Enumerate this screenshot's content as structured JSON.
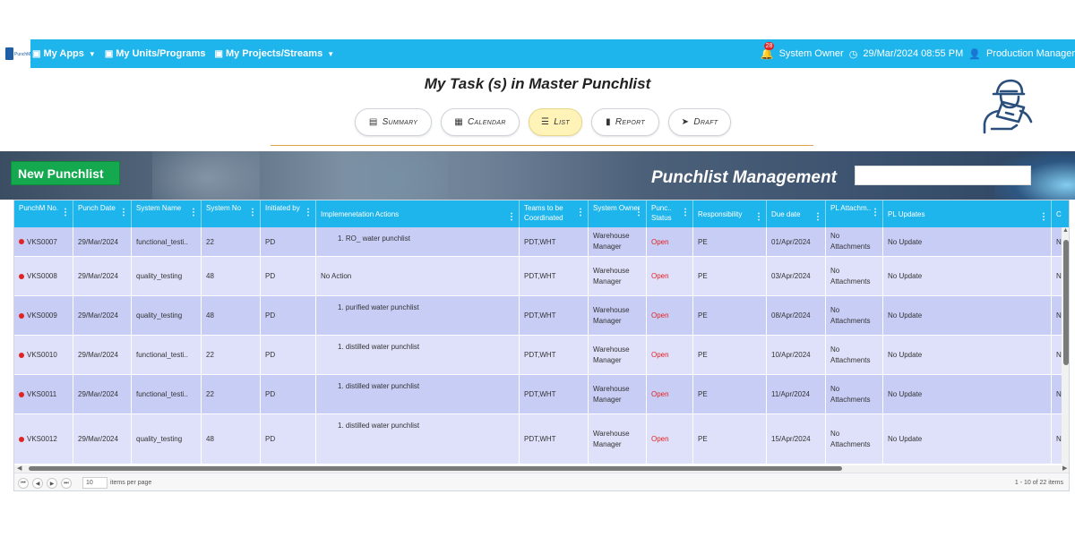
{
  "nav": {
    "items": [
      {
        "label": "My Apps",
        "icon": "briefcase-icon"
      },
      {
        "label": "My Units/Programs",
        "icon": "briefcase-icon"
      },
      {
        "label": "My Projects/Streams",
        "icon": "briefcase-icon"
      }
    ],
    "notification_count": "28",
    "role": "System Owner",
    "datetime": "29/Mar/2024 08:55 PM",
    "user": "Production Manager"
  },
  "page": {
    "title": "My Task (s) in Master Punchlist"
  },
  "tabs": [
    {
      "label": "Summary",
      "icon": "▤",
      "active": false
    },
    {
      "label": "Calendar",
      "icon": "▦",
      "active": false
    },
    {
      "label": "List",
      "icon": "☰",
      "active": true
    },
    {
      "label": "Report",
      "icon": "▮",
      "active": false
    },
    {
      "label": "Draft",
      "icon": "➤",
      "active": false
    }
  ],
  "banner": {
    "new_button": "New Punchlist",
    "title": "Punchlist Management",
    "search_value": ""
  },
  "grid": {
    "columns": [
      "PunchM No.",
      "Punch Date",
      "System Name",
      "System No",
      "Initiated by",
      "Implemenetation Actions",
      "Teams to be Coordinated",
      "System Owner",
      "Punc.. Status",
      "Responsibility",
      "Due date",
      "PL Attachm..",
      "PL Updates",
      "C"
    ],
    "rows": [
      {
        "no": "VKS0007",
        "date": "29/Mar/2024",
        "system": "functional_testi..",
        "sysno": "22",
        "init": "PD",
        "action": "1. RO_ water punchlist",
        "teams": "PDT,WHT",
        "owner": "Warehouse Manager",
        "status": "Open",
        "resp": "PE",
        "due": "01/Apr/2024",
        "attach": "No Attachments",
        "updates": "No Update",
        "extra": "N"
      },
      {
        "no": "VKS0008",
        "date": "29/Mar/2024",
        "system": "quality_testing",
        "sysno": "48",
        "init": "PD",
        "action": "No Action",
        "teams": "PDT,WHT",
        "owner": "Warehouse Manager",
        "status": "Open",
        "resp": "PE",
        "due": "03/Apr/2024",
        "attach": "No Attachments",
        "updates": "No Update",
        "extra": "N"
      },
      {
        "no": "VKS0009",
        "date": "29/Mar/2024",
        "system": "quality_testing",
        "sysno": "48",
        "init": "PD",
        "action": "1. purified water punchlist",
        "teams": "PDT,WHT",
        "owner": "Warehouse Manager",
        "status": "Open",
        "resp": "PE",
        "due": "08/Apr/2024",
        "attach": "No Attachments",
        "updates": "No Update",
        "extra": "N"
      },
      {
        "no": "VKS0010",
        "date": "29/Mar/2024",
        "system": "functional_testi..",
        "sysno": "22",
        "init": "PD",
        "action": "1. distilled water punchlist",
        "teams": "PDT,WHT",
        "owner": "Warehouse Manager",
        "status": "Open",
        "resp": "PE",
        "due": "10/Apr/2024",
        "attach": "No Attachments",
        "updates": "No Update",
        "extra": "N"
      },
      {
        "no": "VKS0011",
        "date": "29/Mar/2024",
        "system": "functional_testi..",
        "sysno": "22",
        "init": "PD",
        "action": "1. distilled water punchlist",
        "teams": "PDT,WHT",
        "owner": "Warehouse Manager",
        "status": "Open",
        "resp": "PE",
        "due": "11/Apr/2024",
        "attach": "No Attachments",
        "updates": "No Update",
        "extra": "N"
      },
      {
        "no": "VKS0012",
        "date": "29/Mar/2024",
        "system": "quality_testing",
        "sysno": "48",
        "init": "PD",
        "action": "1. distilled water punchlist",
        "teams": "PDT,WHT",
        "owner": "Warehouse Manager",
        "status": "Open",
        "resp": "PE",
        "due": "15/Apr/2024",
        "attach": "No Attachments",
        "updates": "No Update",
        "extra": "N"
      }
    ]
  },
  "pager": {
    "page_size": "10",
    "page_size_label": "items per page",
    "info": "1 - 10 of 22 items"
  },
  "colors": {
    "accent": "#1eb4ec",
    "new_button": "#14a84f",
    "status_open": "#e02424",
    "active_tab": "#fff3b8",
    "row_odd": "#c8cdf6",
    "row_even": "#dfe1fa"
  }
}
